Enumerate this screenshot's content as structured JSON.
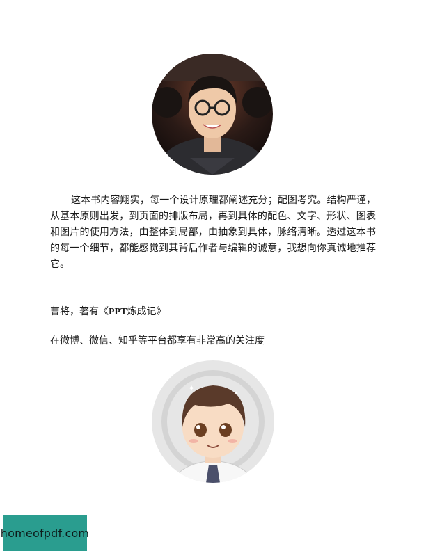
{
  "review": {
    "text": "这本书内容翔实，每一个设计原理都阐述充分；配图考究。结构严谨，从基本原则出发，到页面的排版布局，再到具体的配色、文字、形状、图表和图片的使用方法，由整体到局部，由抽象到具体，脉络清晰。透过这本书的每一个细节，都能感觉到其背后作者与编辑的诚意，我想向你真诚地推荐它。"
  },
  "author": {
    "prefix": "曹将，著有《",
    "book_bold": "PPT",
    "book_rest": "炼成记》",
    "description": "在微博、微信、知乎等平台都享有非常高的关注度"
  },
  "watermark": {
    "text": "homeofpdf.com",
    "color": "#2a9d8f"
  },
  "images": {
    "reviewer_photo": "reviewer-portrait-photo",
    "author_cartoon": "author-cartoon-avatar"
  }
}
